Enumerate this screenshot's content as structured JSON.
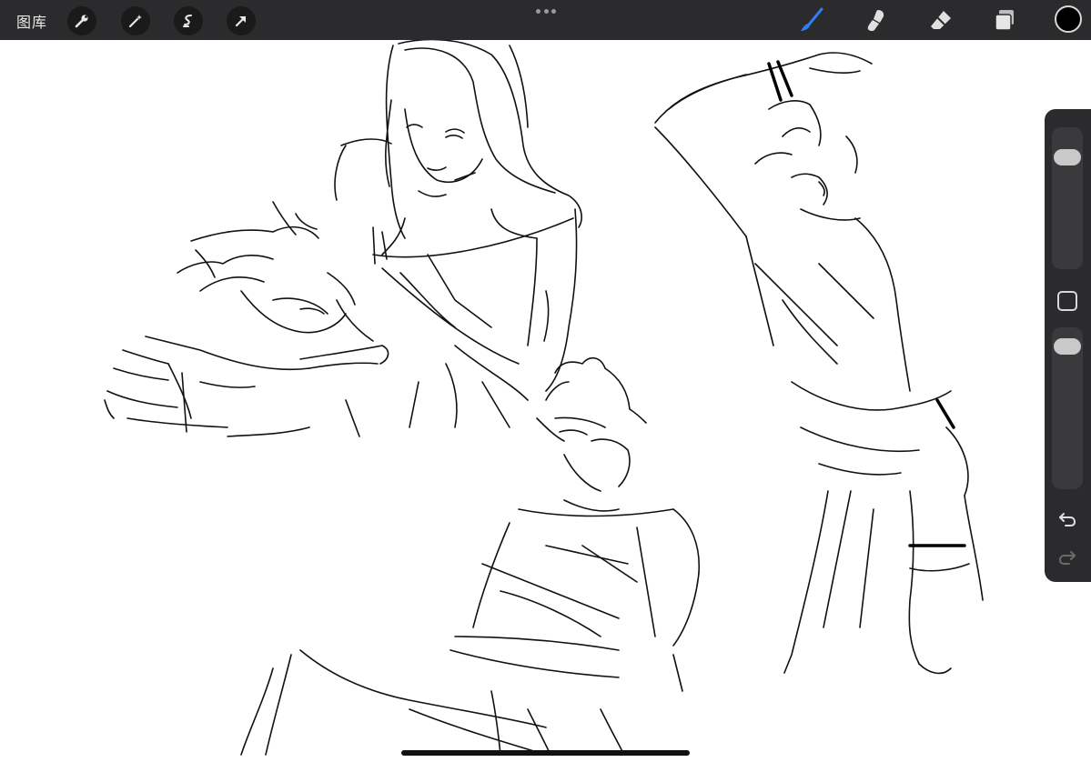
{
  "toolbar": {
    "gallery_label": "图库",
    "left_tools": [
      {
        "icon": "wrench-icon"
      },
      {
        "icon": "magic-wand-icon"
      },
      {
        "icon": "selection-icon"
      },
      {
        "icon": "transform-arrow-icon"
      }
    ],
    "right_tools": [
      {
        "icon": "brush-icon",
        "active": true
      },
      {
        "icon": "smudge-icon",
        "active": false
      },
      {
        "icon": "eraser-icon",
        "active": false
      },
      {
        "icon": "layers-icon",
        "active": false
      }
    ],
    "current_color": "#000000",
    "accent_color": "#2f7cf6"
  },
  "sidebar": {
    "brush_size_level": 0.85,
    "opacity_level": 0.95,
    "modify_icon": "square-modify-icon",
    "undo_icon": "undo-icon",
    "redo_icon": "redo-icon"
  }
}
